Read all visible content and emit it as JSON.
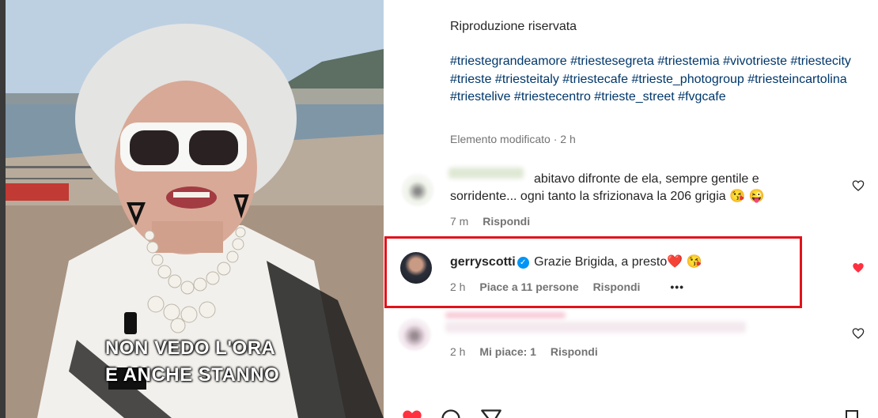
{
  "post": {
    "description": "Riproduzione riservata",
    "hashtags": "#triestegrandeamore #triestesegreta #triestemia #vivotrieste #triestecity #trieste #triesteitaly #triestecafe #trieste_photogroup #triesteincartolina #triestelive #triestecentro #trieste_street #fvgcafe",
    "edited_label": "Elemento modificato · 2 h"
  },
  "video": {
    "caption_line1": "NON VEDO L'ORA",
    "caption_line2": "E ANCHE STANNO"
  },
  "comments": [
    {
      "username": "",
      "text": "abitavo difronte de ela, sempre gentile e sorridente... ogni tanto la sfrizionava la 206 grigia 😘 😜",
      "time": "7 m",
      "reply": "Rispondi",
      "liked": false
    },
    {
      "username": "gerryscotti",
      "verified": true,
      "text": "Grazie Brigida, a presto❤️ 😘",
      "time": "2 h",
      "likes": "Piace a 11 persone",
      "reply": "Rispondi",
      "more": "•••",
      "liked": true
    },
    {
      "username": "",
      "text": "",
      "time": "2 h",
      "likes": "Mi piace: 1",
      "reply": "Rispondi",
      "liked": false
    }
  ],
  "icons": {
    "heart_outline": "heart-outline-icon",
    "heart_filled": "heart-filled-icon",
    "verified": "verified-badge-icon",
    "comment": "comment-icon",
    "share": "share-icon",
    "save": "bookmark-icon"
  },
  "colors": {
    "like_red": "#ff3040",
    "link_blue": "#00376b",
    "highlight_red": "#e1121a",
    "verified_blue": "#0095f6"
  }
}
